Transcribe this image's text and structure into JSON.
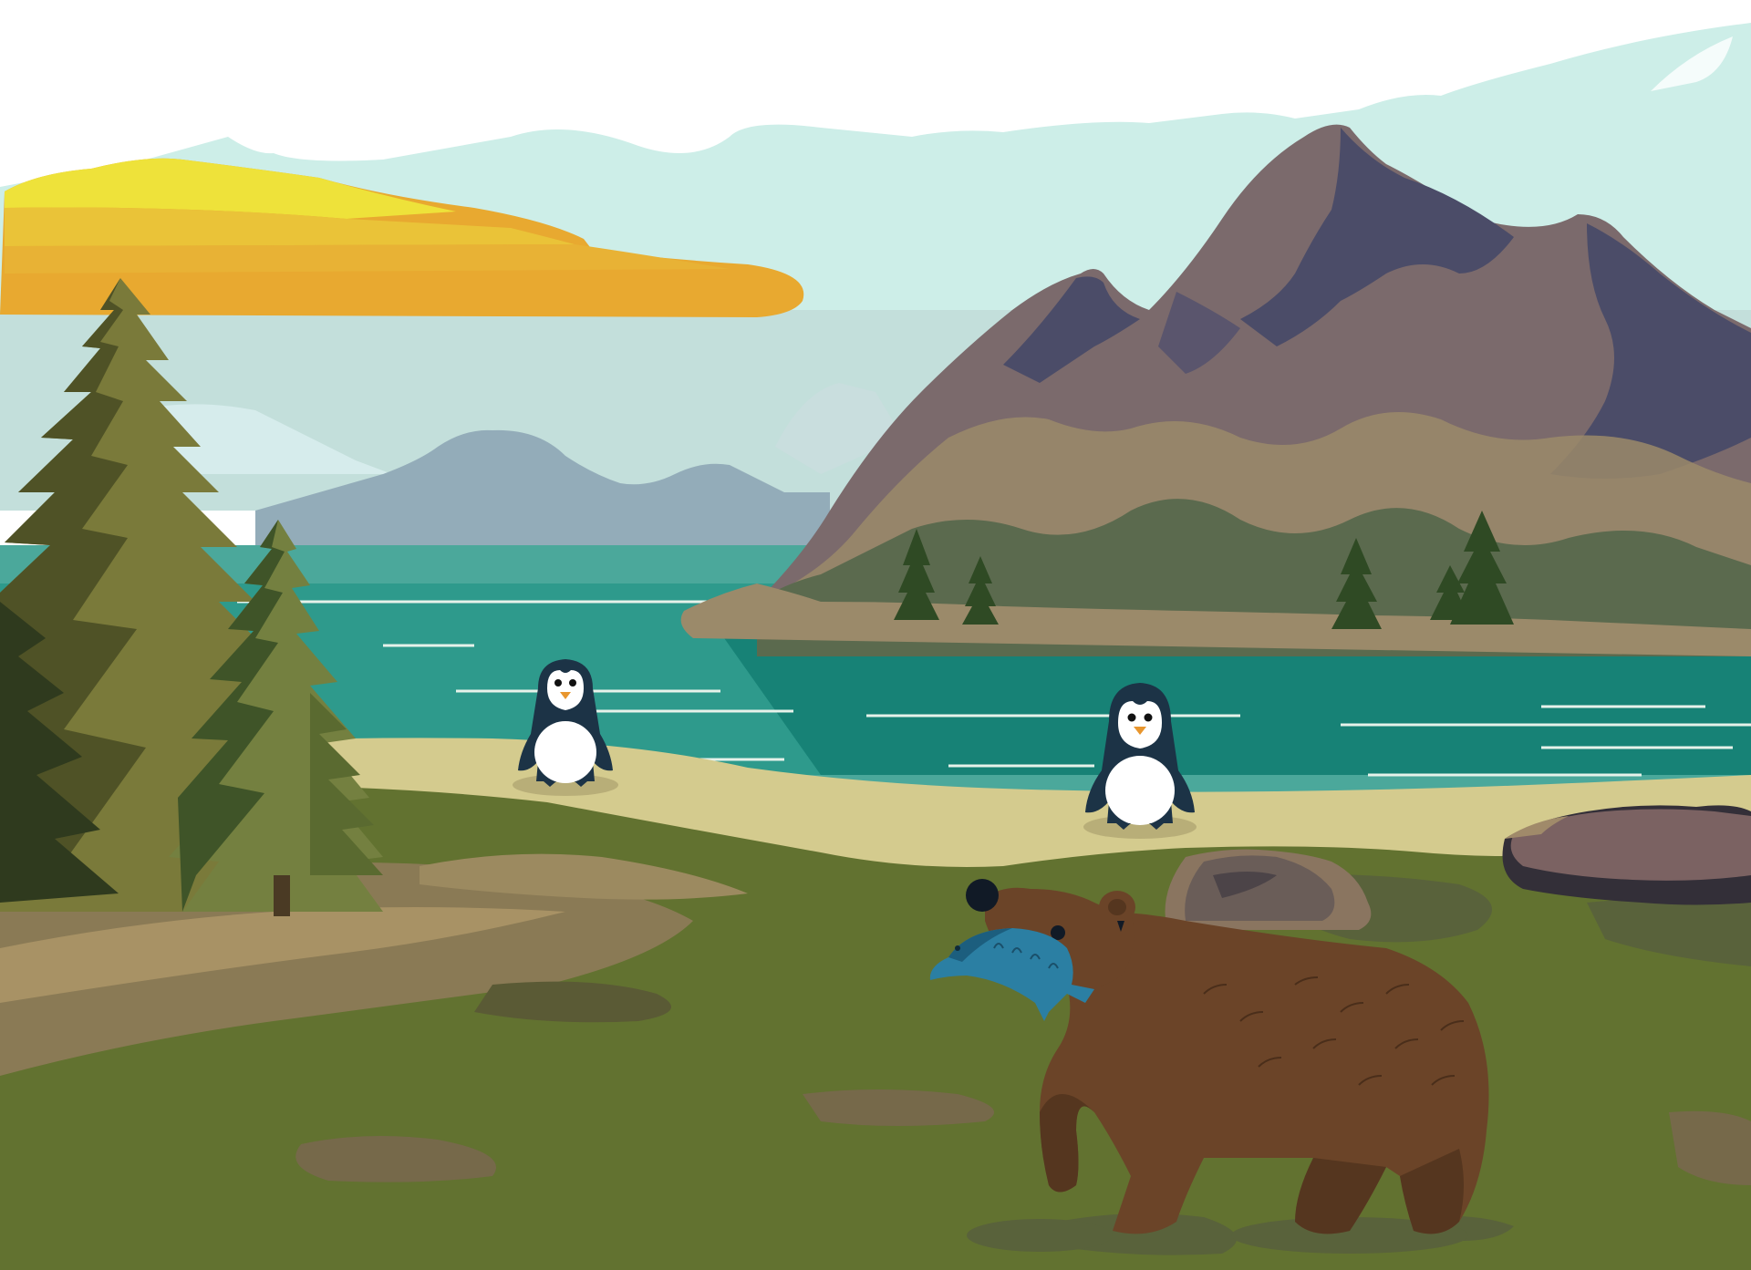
{
  "scene": {
    "palette": {
      "sky_light": "#cdeee8",
      "sky_haze": "#c3dfdb",
      "cloud_gold": "#e8a930",
      "cloud_yellow": "#eee23a",
      "far_hills": "#93acb9",
      "lake": "#4ba89b",
      "lake_deep": "#178276",
      "beach": "#d4cb8e",
      "grass": "#627230",
      "mountain": "#7b6a6c",
      "mountain_shadow": "#4b4c68",
      "bear": "#6b4428",
      "fish": "#2b7fa3"
    },
    "subjects": [
      "penguin-left",
      "penguin-right",
      "bear-with-fish",
      "pine-trees",
      "mountains",
      "lake",
      "rocks"
    ]
  }
}
